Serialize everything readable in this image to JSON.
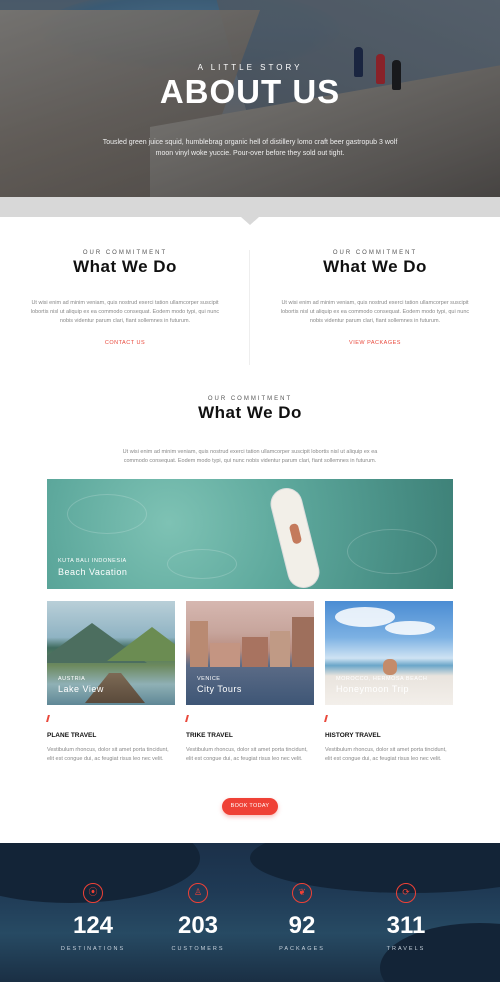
{
  "hero": {
    "kicker": "A LITTLE STORY",
    "title": "ABOUT US",
    "description": "Tousled green juice squid, humblebrag organic hell of distillery lomo craft beer gastropub 3 wolf moon vinyl woke yuccie. Pour-over before they sold out tight."
  },
  "commitments": [
    {
      "kicker": "OUR COMMITMENT",
      "title": "What We Do",
      "text": "Ut wisi enim ad minim veniam, quis nostrud exerci tation ullamcorper suscipit lobortis nisl ut aliquip ex ea commodo consequat. Eodem modo typi, qui nunc nobis videntur parum clari, fiant sollemnes in futurum.",
      "link": "CONTACT US"
    },
    {
      "kicker": "OUR COMMITMENT",
      "title": "What We Do",
      "text": "Ut wisi enim ad minim veniam, quis nostrud exerci tation ullamcorper suscipit lobortis nisl ut aliquip ex ea commodo consequat. Eodem modo typi, qui nunc nobis videntur parum clari, fiant sollemnes in futurum.",
      "link": "VIEW PACKAGES"
    }
  ],
  "center": {
    "kicker": "OUR COMMITMENT",
    "title": "What We Do",
    "text": "Ut wisi enim ad minim veniam, quis nostrud exerci tation ullamcorper suscipit lobortis nisl ut aliquip ex ea commodo consequat. Eodem modo typi, qui nunc nobis videntur parum clari, fiant sollemnes in futurum."
  },
  "destinations": {
    "beach": {
      "location": "KUTA BALI INDONESIA",
      "name": "Beach Vacation"
    },
    "lake": {
      "location": "AUSTRIA",
      "name": "Lake View"
    },
    "city": {
      "location": "VENICE",
      "name": "City Tours"
    },
    "honey": {
      "location": "MOROCCO, HERMOSA BEACH",
      "name": "Honeymoon Trip"
    }
  },
  "features": [
    {
      "title": "PLANE TRAVEL",
      "text": "Vestibulum rhoncus, dolor sit amet porta tincidunt, elit est congue dui, ac feugiat risus leo nec velit."
    },
    {
      "title": "TRIKE TRAVEL",
      "text": "Vestibulum rhoncus, dolor sit amet porta tincidunt, elit est congue dui, ac feugiat risus leo nec velit."
    },
    {
      "title": "HISTORY TRAVEL",
      "text": "Vestibulum rhoncus, dolor sit amet porta tincidunt, elit est congue dui, ac feugiat risus leo nec velit."
    }
  ],
  "cta": {
    "label": "BOOK TODAY"
  },
  "stats": [
    {
      "icon": "map-pin-icon",
      "glyph": "⦿",
      "number": "124",
      "label": "DESTINATIONS"
    },
    {
      "icon": "customer-icon",
      "glyph": "♙",
      "number": "203",
      "label": "CUSTOMERS"
    },
    {
      "icon": "leaf-icon",
      "glyph": "❦",
      "number": "92",
      "label": "PACKAGES"
    },
    {
      "icon": "travel-cycle-icon",
      "glyph": "⟳",
      "number": "311",
      "label": "TRAVELS"
    }
  ],
  "colors": {
    "accent": "#ef4136",
    "dark_section": "#1f3a55",
    "band": "#d8d8d8"
  }
}
